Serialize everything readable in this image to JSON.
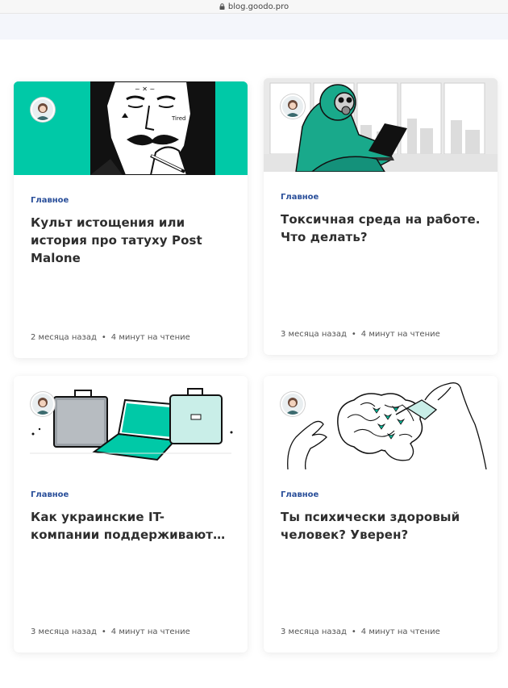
{
  "browser": {
    "url": "blog.goodo.pro"
  },
  "cards": [
    {
      "category": "Главное",
      "title": "Культ истощения или история про татуху Post Malone",
      "age": "2 месяца назад",
      "read_time": "4 минут на чтение",
      "image": "man-with-face-tattoos-smoking",
      "image_bg": "#00c9a7"
    },
    {
      "category": "Главное",
      "title": "Токсичная среда на работе. Что делать?",
      "age": "3 месяца назад",
      "read_time": "4 минут на чтение",
      "image": "person-in-hazmat-suit-with-laptop",
      "image_bg": "#e9e9e9"
    },
    {
      "category": "Главное",
      "title": "Как украинские IT-компании поддерживают…",
      "age": "3 месяца назад",
      "read_time": "4 минут на чтение",
      "image": "briefcases",
      "image_bg": "#ffffff"
    },
    {
      "category": "Главное",
      "title": "Ты психически здоровый человек? Уверен?",
      "age": "3 месяца назад",
      "read_time": "4 минут на чтение",
      "image": "hand-watering-brain-plants",
      "image_bg": "#ffffff"
    }
  ],
  "colors": {
    "category": "#2a4f9a",
    "accent": "#00c9a7"
  }
}
